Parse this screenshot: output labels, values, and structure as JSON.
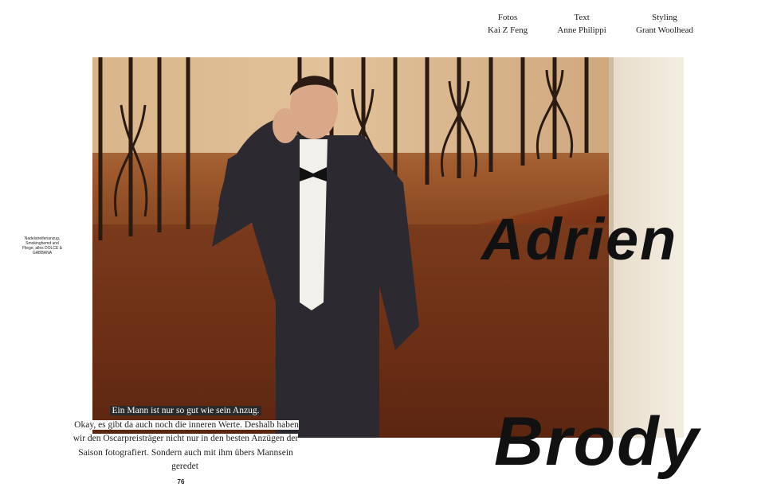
{
  "credits": [
    {
      "role": "Fotos",
      "name": "Kai Z Feng"
    },
    {
      "role": "Text",
      "name": "Anne Philippi"
    },
    {
      "role": "Styling",
      "name": "Grant Woolhead"
    }
  ],
  "side_caption": "Nadelstreifenanzug, Smokinghemd und Fliege, alles DOLCE & GABBANA",
  "title": {
    "first": "Adrien",
    "last": "Brody"
  },
  "intro": {
    "line1": "Ein Mann ist nur so gut wie sein Anzug.",
    "rest": "Okay, es gibt da auch noch die inneren Werte. Deshalb haben wir den Oscarpreisträger nicht nur in den besten Anzügen der Saison fotografiert. Sondern auch mit ihm übers Mannsein geredet"
  },
  "page_number": "76"
}
